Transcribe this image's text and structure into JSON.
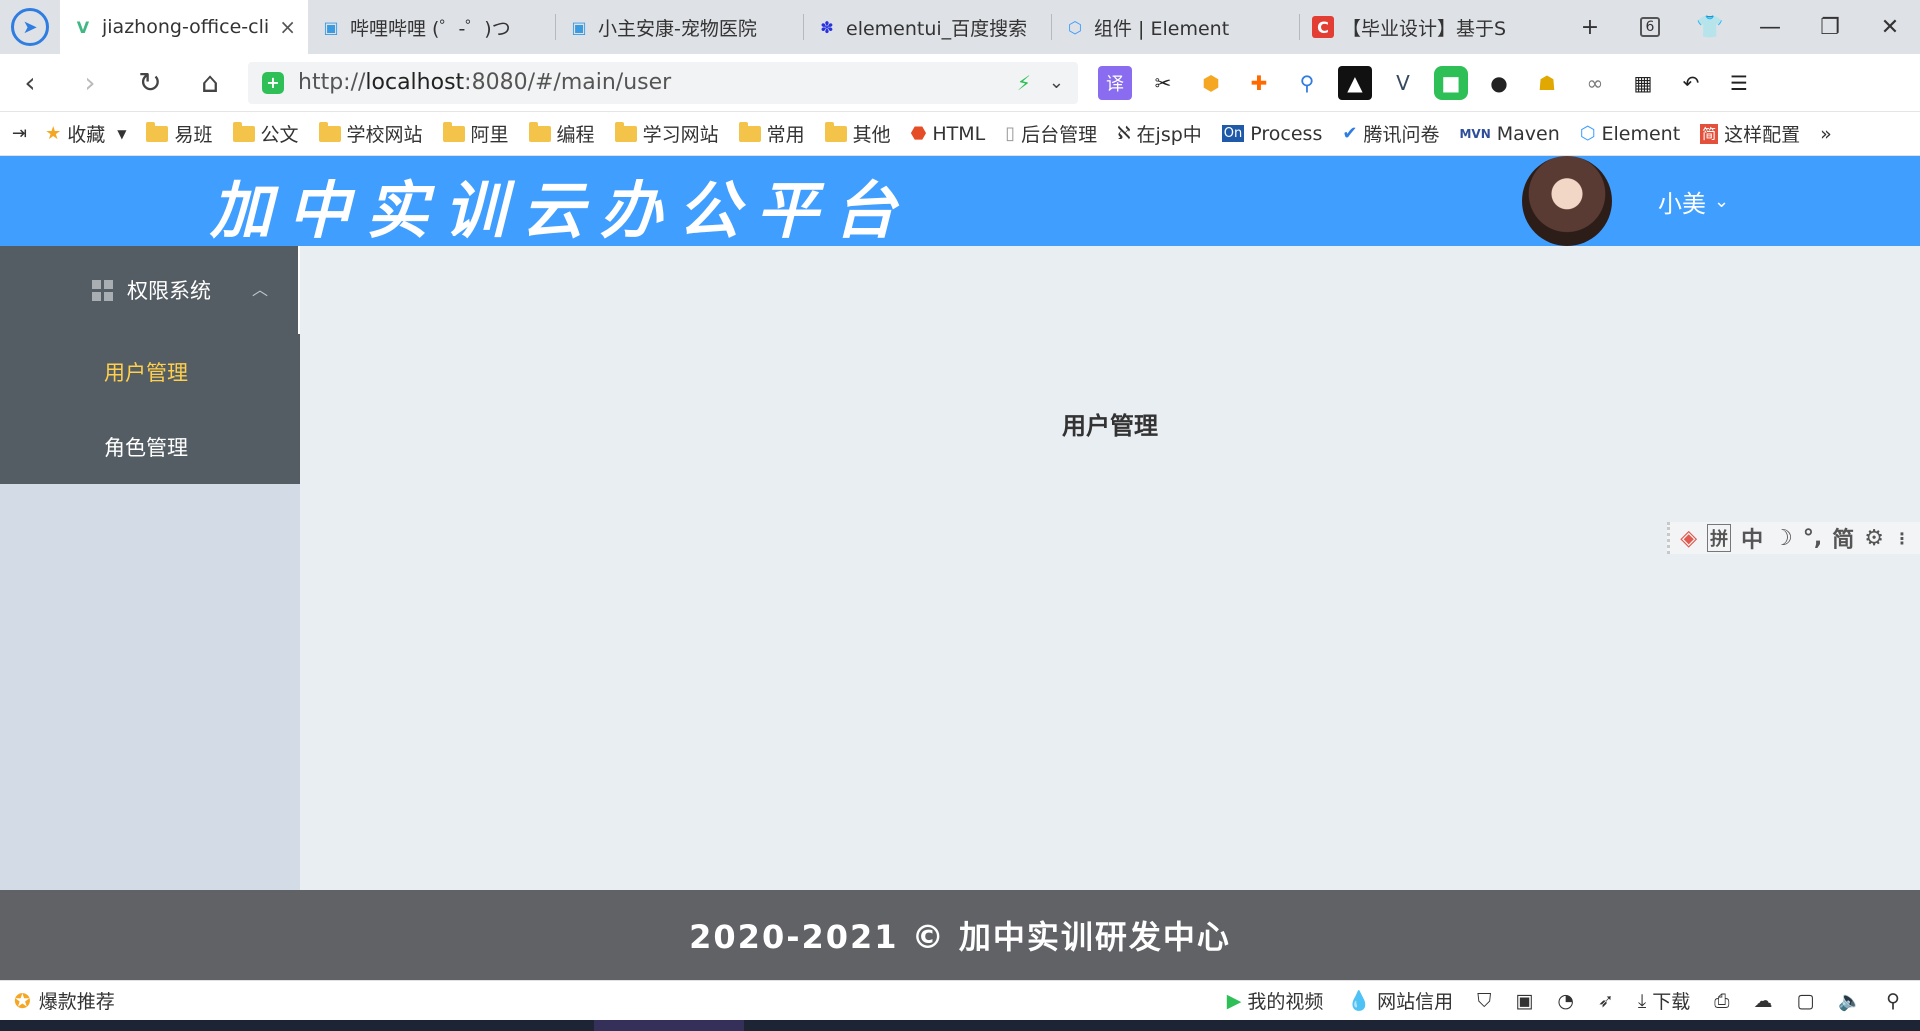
{
  "browser": {
    "tabs": [
      {
        "title": "jiazhong-office-cli",
        "icon": "vue-icon",
        "active": true
      },
      {
        "title": "哔哩哔哩 (゜-゜)つ",
        "icon": "bilibili-icon"
      },
      {
        "title": "小主安康-宠物医院",
        "icon": "bilibili-icon"
      },
      {
        "title": "elementui_百度搜索",
        "icon": "baidu-icon"
      },
      {
        "title": "组件 | Element",
        "icon": "element-icon"
      },
      {
        "title": "【毕业设计】基于S",
        "icon": "csdn-icon"
      }
    ],
    "tab_close": "×",
    "new_tab": "+",
    "tab_count": "6",
    "url_prefix": "http://",
    "url_host": "localhost",
    "url_rest": ":8080/#/main/user",
    "extensions": [
      "translate-icon",
      "scissors-icon",
      "coin-icon",
      "game-icon",
      "search-icon",
      "dark-icon",
      "vue-devtools-icon",
      "green-icon",
      "panda-icon",
      "cat-icon",
      "link-icon",
      "grid-icon",
      "undo-icon",
      "menu-icon"
    ],
    "ext_translate_label": "译"
  },
  "bookmarks": {
    "favorites": "收藏",
    "items": [
      {
        "label": "易班",
        "type": "folder"
      },
      {
        "label": "公文",
        "type": "folder"
      },
      {
        "label": "学校网站",
        "type": "folder"
      },
      {
        "label": "阿里",
        "type": "folder"
      },
      {
        "label": "编程",
        "type": "folder"
      },
      {
        "label": "学习网站",
        "type": "folder"
      },
      {
        "label": "常用",
        "type": "folder"
      },
      {
        "label": "其他",
        "type": "folder"
      },
      {
        "label": "HTML",
        "type": "link"
      },
      {
        "label": "后台管理",
        "type": "link"
      },
      {
        "label": "在jsp中",
        "type": "link"
      },
      {
        "label": "Process",
        "type": "link"
      },
      {
        "label": "腾讯问卷",
        "type": "link"
      },
      {
        "label": "Maven",
        "type": "link"
      },
      {
        "label": "Element",
        "type": "link"
      },
      {
        "label": "这样配置",
        "type": "link"
      }
    ],
    "more": "»"
  },
  "app": {
    "title": "加中实训云办公平台",
    "user_name": "小美",
    "sidebar": {
      "group_title": "权限系统",
      "items": [
        {
          "label": "用户管理",
          "active": true
        },
        {
          "label": "角色管理",
          "active": false
        }
      ]
    },
    "main_title": "用户管理",
    "ime_toolbar": [
      "拼",
      "中",
      "简"
    ],
    "footer": "2020-2021 © 加中实训研发中心"
  },
  "statusbar": {
    "recommend": "爆款推荐",
    "my_video": "我的视频",
    "site_credit": "网站信用",
    "download": "下载"
  },
  "colors": {
    "header_bg": "#409eff",
    "menu_bg": "#545c64",
    "menu_active": "#ffd04b",
    "main_bg": "#e9eef3",
    "aside_bg": "#d3dce6",
    "footer_bg": "#606266"
  }
}
